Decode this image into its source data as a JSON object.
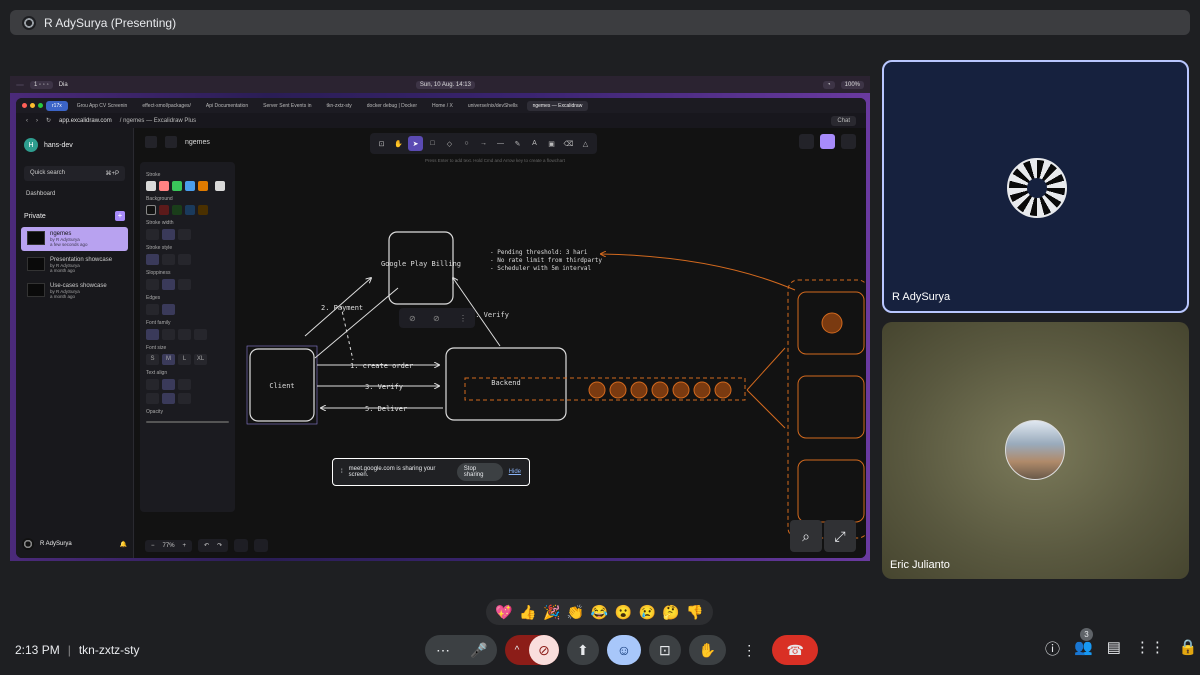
{
  "presenter": {
    "label": "R AdySurya (Presenting)"
  },
  "screen": {
    "menubar": {
      "app_name": "Dia",
      "datetime": "Sun, 10 Aug. 14:13",
      "battery": "100%"
    },
    "tabs": [
      {
        "label": "r17x"
      },
      {
        "label": "Grou App CV Screenin"
      },
      {
        "label": "effect-smol/packages/"
      },
      {
        "label": "Api Documentation"
      },
      {
        "label": "Server Sent Events in"
      },
      {
        "label": "tkn-zxtz-sty"
      },
      {
        "label": "docker debug | Docker"
      },
      {
        "label": "Home / X"
      },
      {
        "label": "universe/nix/devShells"
      },
      {
        "label": "ngemes — Excalidraw"
      }
    ],
    "url": "app.excalidraw.com",
    "url_title": "/ ngemes — Excalidraw Plus",
    "chat_label": "Chat",
    "sidebar": {
      "workspace": "hans-dev",
      "workspace_initial": "H",
      "search_placeholder": "Quick search",
      "search_shortcut": "⌘+P",
      "dashboard": "Dashboard",
      "section": "Private",
      "files": [
        {
          "name": "ngemes",
          "author": "by R AdySurya",
          "time": "a few seconds ago"
        },
        {
          "name": "Presentation showcase",
          "author": "by R AdySurya",
          "time": "a month ago"
        },
        {
          "name": "Use-cases showcase",
          "author": "by R AdySurya",
          "time": "a month ago"
        }
      ],
      "user": "R AdySurya"
    },
    "canvas": {
      "doc_title": "ngemes",
      "hint": "Press Enter to add text. Hold Cmd and Arrow key to create a flowchart",
      "props": {
        "stroke": "Stroke",
        "background": "Background",
        "stroke_width": "Stroke width",
        "stroke_style": "Stroke style",
        "sloppiness": "Sloppiness",
        "edges": "Edges",
        "font_family": "Font family",
        "font_size": "Font size",
        "font_sizes": [
          "S",
          "M",
          "L",
          "XL"
        ],
        "text_align": "Text align",
        "opacity": "Opacity",
        "stroke_colors": [
          "#d9d9d9",
          "#ff8383",
          "#3ac55a",
          "#4a9eed",
          "#e07b00",
          "#d9d9d9"
        ],
        "bg_colors": [
          "#121212",
          "#5c1a1a",
          "#1a3d1a",
          "#1a3a5c",
          "#4a3000"
        ]
      },
      "zoom": "77%",
      "diagram": {
        "google_play": "Google Play Billing",
        "client": "Client",
        "backend": "Backend",
        "payment": "2. Payment",
        "verify_top": "4. Verify",
        "create_order": "1. create order",
        "verify": "3. Verify",
        "deliver": "5. Deliver",
        "notes": [
          "- Pending threshold: 3 hari",
          "- No rate limit from thirdparty",
          "- Scheduler with 5m interval"
        ]
      }
    },
    "sharing_text": "meet.google.com is sharing your screen.",
    "stop_sharing": "Stop sharing",
    "hide": "Hide"
  },
  "participants": [
    {
      "name": "R AdySurya"
    },
    {
      "name": "Eric Julianto"
    }
  ],
  "reactions": [
    "💖",
    "👍",
    "🎉",
    "👏",
    "😂",
    "😮",
    "😢",
    "🤔",
    "👎"
  ],
  "meeting": {
    "time": "2:13 PM",
    "code": "tkn-zxtz-sty",
    "participant_count": "3"
  }
}
